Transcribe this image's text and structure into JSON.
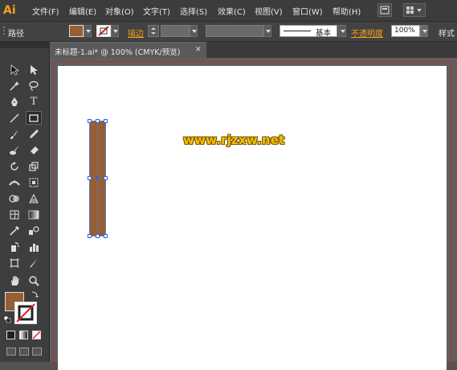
{
  "app": {
    "logo": "Ai"
  },
  "menu": {
    "items": [
      "文件(F)",
      "编辑(E)",
      "对象(O)",
      "文字(T)",
      "选择(S)",
      "效果(C)",
      "视图(V)",
      "窗口(W)",
      "帮助(H)"
    ]
  },
  "control_bar": {
    "object_type": "路径",
    "fill_color": "#955f33",
    "stroke_label": "描边",
    "stroke_style": "基本",
    "opacity_label": "不透明度",
    "opacity_value": "100%",
    "style_label": "样式"
  },
  "document": {
    "tab_title": "未标题-1.ai* @ 100% (CMYK/预览)",
    "close_glyph": "✕"
  },
  "canvas": {
    "watermark": "www.rjzxw.net"
  },
  "colors": {
    "fill": "#955f33",
    "accent": "#f7a21b",
    "artboard_border": "#b03030",
    "selection": "#3a63d8"
  },
  "tools": [
    "selection-tool",
    "direct-selection-tool",
    "magic-wand-tool",
    "lasso-tool",
    "pen-tool",
    "type-tool",
    "line-tool",
    "rectangle-tool",
    "paintbrush-tool",
    "pencil-tool",
    "blob-brush-tool",
    "eraser-tool",
    "rotate-tool",
    "scale-tool",
    "width-tool",
    "free-transform-tool",
    "shape-builder-tool",
    "perspective-grid-tool",
    "mesh-tool",
    "gradient-tool",
    "eyedropper-tool",
    "blend-tool",
    "symbol-sprayer-tool",
    "column-graph-tool",
    "artboard-tool",
    "slice-tool",
    "hand-tool",
    "zoom-tool"
  ]
}
